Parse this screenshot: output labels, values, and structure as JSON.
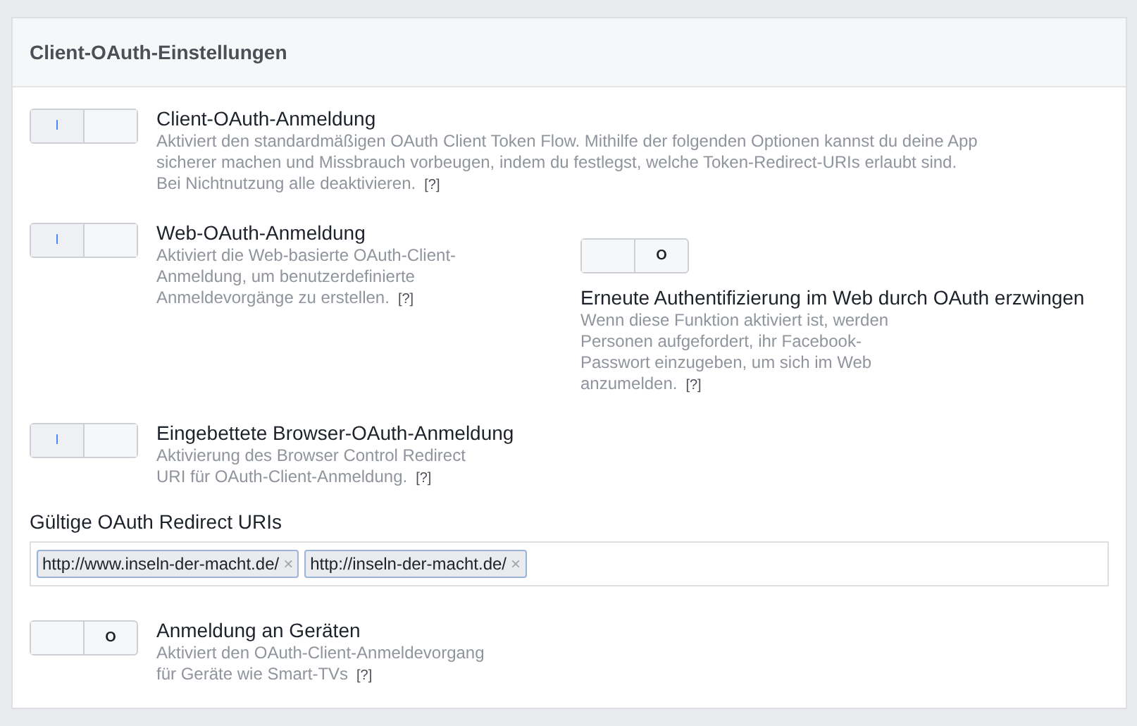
{
  "panel": {
    "title": "Client-OAuth-Einstellungen"
  },
  "sections": [
    {
      "kind": "toggle",
      "items": [
        {
          "title": "Client-OAuth-Anmeldung",
          "on": true,
          "mark": "I",
          "kind": "side",
          "lines": [
            "Aktiviert den standardmäßigen OAuth Client Token Flow. Mithilfe der folgenden Optionen kannst du deine App",
            "sicherer machen und Missbrauch vorbeugen, indem du festlegst, welche Token-Redirect-URIs erlaubt sind.",
            "Bei Nichtnutzung alle deaktivieren."
          ],
          "help": "[?]"
        }
      ]
    },
    {
      "kind": "toggle",
      "items": [
        {
          "title": "Web-OAuth-Anmeldung",
          "on": true,
          "mark": "I",
          "kind": "side",
          "lines": [
            "Aktiviert die Web-basierte OAuth-Client-",
            "Anmeldung, um benutzerdefinierte",
            "Anmeldevorgänge zu erstellen."
          ],
          "help": "[?]"
        },
        {
          "title": "Erneute Authentifizierung im Web durch OAuth erzwingen",
          "on": false,
          "mark": "O",
          "kind": "stacked",
          "lines": [
            "Wenn diese Funktion aktiviert ist, werden",
            "Personen aufgefordert, ihr Facebook-",
            "Passwort einzugeben, um sich im Web",
            "anzumelden."
          ],
          "help": "[?]"
        }
      ]
    },
    {
      "kind": "toggle",
      "items": [
        {
          "title": "Eingebettete Browser-OAuth-Anmeldung",
          "on": true,
          "mark": "I",
          "kind": "side",
          "lines": [
            "Aktivierung des Browser Control Redirect",
            "URI für OAuth-Client-Anmeldung."
          ],
          "help": "[?]"
        }
      ]
    },
    {
      "kind": "uris",
      "label": "Gültige OAuth Redirect URIs",
      "tags": [
        {
          "text": "http://www.inseln-der-macht.de/",
          "remove": "×"
        },
        {
          "text": "http://inseln-der-macht.de/",
          "remove": "×"
        }
      ]
    },
    {
      "kind": "toggle",
      "items": [
        {
          "title": "Anmeldung an Geräten",
          "on": false,
          "mark": "O",
          "kind": "side",
          "lines": [
            "Aktiviert den OAuth-Client-Anmeldevorgang",
            "für Geräte wie Smart-TVs"
          ],
          "help": "[?]"
        }
      ]
    }
  ]
}
